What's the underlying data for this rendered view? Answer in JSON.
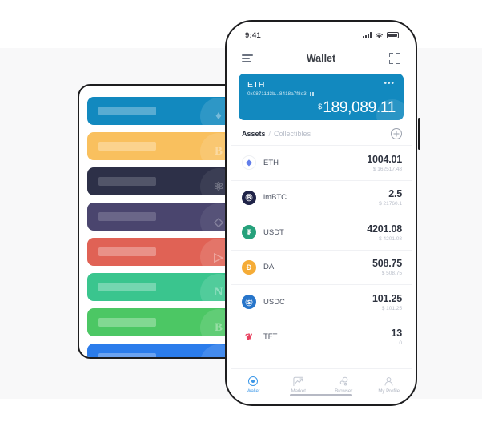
{
  "statusbar": {
    "time": "9:41",
    "signal_icon": "signal-bars-icon",
    "wifi_icon": "wifi-icon",
    "battery_icon": "battery-icon"
  },
  "navbar": {
    "title": "Wallet",
    "menu_icon": "hamburger-menu-icon",
    "scan_icon": "scan-qr-icon"
  },
  "balance_card": {
    "name": "ETH",
    "address": "0x08711d3b...8418a7f8e3",
    "copy_icon": "qr-code-icon",
    "more_icon": "more-dots-icon",
    "currency_symbol": "$",
    "amount": "189,089.11",
    "accent_color": "#1289bf"
  },
  "assets_header": {
    "tab_assets": "Assets",
    "separator": "/",
    "tab_collectibles": "Collectibles",
    "add_icon": "plus-circle-icon"
  },
  "assets": [
    {
      "symbol": "ETH",
      "amount": "1004.01",
      "fiat": "$ 162517.48",
      "icon": "eth-coin-icon",
      "color": "#627eea"
    },
    {
      "symbol": "imBTC",
      "amount": "2.5",
      "fiat": "$ 21760.1",
      "icon": "imbtc-coin-icon",
      "color": "#1f2348"
    },
    {
      "symbol": "USDT",
      "amount": "4201.08",
      "fiat": "$ 4201.08",
      "icon": "usdt-coin-icon",
      "color": "#26a17b"
    },
    {
      "symbol": "DAI",
      "amount": "508.75",
      "fiat": "$ 508.75",
      "icon": "dai-coin-icon",
      "color": "#f5ac37"
    },
    {
      "symbol": "USDC",
      "amount": "101.25",
      "fiat": "$ 101.25",
      "icon": "usdc-coin-icon",
      "color": "#2775ca"
    },
    {
      "symbol": "TFT",
      "amount": "13",
      "fiat": "0",
      "icon": "tft-coin-icon",
      "color": "#e8415f"
    }
  ],
  "tabbar": {
    "active_color": "#3b97e8",
    "items": [
      {
        "label": "Wallet",
        "icon": "wallet-ring-icon",
        "active": true
      },
      {
        "label": "Market",
        "icon": "market-chart-icon",
        "active": false
      },
      {
        "label": "Browser",
        "icon": "browser-nodes-icon",
        "active": false
      },
      {
        "label": "My Profile",
        "icon": "profile-person-icon",
        "active": false
      }
    ]
  },
  "cards_panel": {
    "cards": [
      {
        "glyph": "♦",
        "color": "#1289bf",
        "name": "eth-placeholder-card",
        "dark": false
      },
      {
        "glyph": "B",
        "color": "#f9c05e",
        "name": "btc-placeholder-card",
        "dark": false
      },
      {
        "glyph": "⚛",
        "color": "#2d3048",
        "name": "atom-placeholder-card",
        "dark": true
      },
      {
        "glyph": "◇",
        "color": "#4a456e",
        "name": "drop-placeholder-card",
        "dark": true
      },
      {
        "glyph": "▷",
        "color": "#e06255",
        "name": "tron-placeholder-card",
        "dark": false
      },
      {
        "glyph": "N",
        "color": "#3ac58e",
        "name": "neo-placeholder-card",
        "dark": false
      },
      {
        "glyph": "B",
        "color": "#4cc764",
        "name": "bch-placeholder-card",
        "dark": false
      },
      {
        "glyph": "L",
        "color": "#2b7ceb",
        "name": "ltc-placeholder-card",
        "dark": false
      }
    ]
  }
}
